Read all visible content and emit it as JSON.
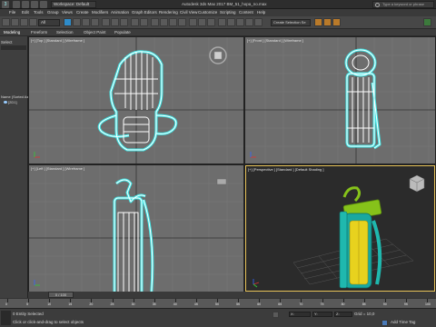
{
  "titlebar": {
    "workspace_label": "Workspace: Default",
    "app_title": "Autodesk 3ds Max 2017    BM_51_hopa_no.max",
    "search_placeholder": "Type a keyword or phrase"
  },
  "menu": {
    "items": [
      "File",
      "Edit",
      "Tools",
      "Group",
      "Views",
      "Create",
      "Modifiers",
      "Animation",
      "Graph Editors",
      "Rendering",
      "Civil View",
      "Customize",
      "Scripting",
      "Content",
      "Help"
    ]
  },
  "toolbar": {
    "view_dropdown": "All",
    "selection_set": "Create Selection Se"
  },
  "ribbon": {
    "tabs": [
      "Modeling",
      "Freeform",
      "Selection",
      "Object Paint",
      "Populate"
    ]
  },
  "scene_explorer": {
    "header": "Select",
    "item_1": "Name (Sorted As",
    "item_2": "[2D1]"
  },
  "viewports": {
    "top": {
      "label": "[+] [Top ] [Standard ] [Wireframe ]"
    },
    "front": {
      "label": "[+] [Front ] [Standard ] [Wireframe ]"
    },
    "left": {
      "label": "[+] [Left ] [Standard ] [Wireframe ]"
    },
    "perspective": {
      "label": "[+] [Perspective ] [Standard ] [Default Shading ]"
    }
  },
  "timeline": {
    "frame_label": "0 / 100",
    "ticks": [
      "0",
      "5",
      "10",
      "15",
      "20",
      "25",
      "30",
      "35",
      "40",
      "45",
      "50",
      "55",
      "60",
      "65",
      "70",
      "75",
      "80",
      "85",
      "90",
      "95",
      "100"
    ]
  },
  "status": {
    "selection": "0 Entity Selected",
    "prompt": "Click or click-and-drag to select objects",
    "grid": "Grid = 10,0",
    "add_time_tag": "Add Time Tag",
    "x_label": "X:",
    "y_label": "Y:",
    "z_label": "Z:"
  },
  "colors": {
    "wire": "#ffffff",
    "select_outline": "#3fe6e6",
    "body_yellow": "#e8d21e",
    "lever_green": "#86c21a",
    "teal": "#18a8a0",
    "active_border": "#e8c35a"
  }
}
